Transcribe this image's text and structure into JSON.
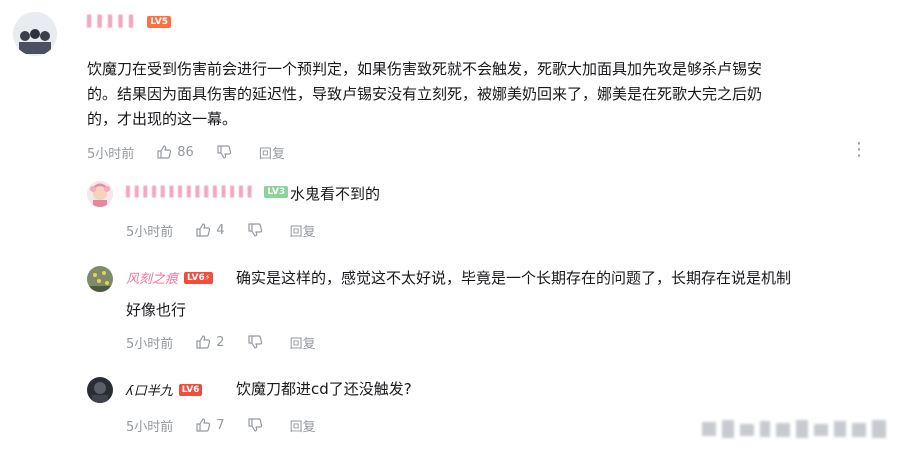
{
  "comments": [
    {
      "username_blurred": "▌▌▌▌▌",
      "level": "LV5",
      "level_color": "#ff6f3f",
      "text_lines": [
        "饮魔刀在受到伤害前会进行一个预判定，如果伤害致死就不会触发，死歌大加面具加先攻是够杀卢锡安",
        "的。结果因为面具伤害的延迟性，导致卢锡安没有立刻死，被娜美奶回来了，娜美是在死歌大完之后奶",
        "的，才出现的这一幕。"
      ],
      "time": "5小时前",
      "likes": "86",
      "reply_label": "回复",
      "more_icon": "⋮",
      "replies": [
        {
          "username_blurred": "▌▌▌▌▌▌▌▌▌▌▌▌▌▌▌",
          "level": "LV3",
          "level_color": "#8bd29b",
          "text_lines": [
            "水鬼看不到的"
          ],
          "time": "5小时前",
          "likes": "4",
          "reply_label": "回复"
        },
        {
          "username": "风刻之痕",
          "username_color": "#fb7299",
          "level": "LV6",
          "level_extra": "⚡",
          "level_color": "#f14c3c",
          "text_lines": [
            "确实是这样的，感觉这不太好说，毕竟是一个长期存在的问题了，长期存在说是机制",
            "好像也行"
          ],
          "time": "5小时前",
          "likes": "2",
          "reply_label": "回复"
        },
        {
          "username": "ʎ口半九",
          "level": "LV6",
          "level_color": "#f14c3c",
          "text_lines": [
            "饮魔刀都进cd了还没触发?"
          ],
          "time": "5小时前",
          "likes": "7",
          "reply_label": "回复"
        }
      ]
    }
  ]
}
